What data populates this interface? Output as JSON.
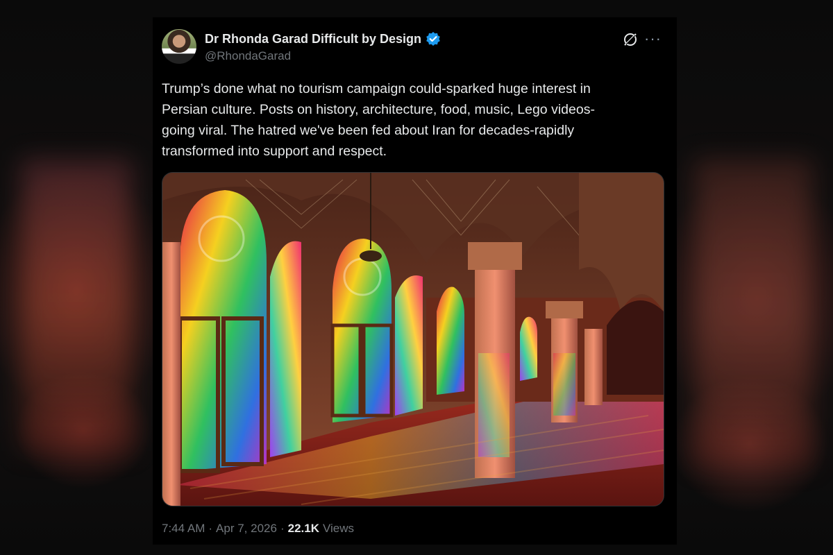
{
  "tweet": {
    "author": {
      "display_name": "Dr Rhonda Garad Difficult by Design",
      "handle": "@RhondaGarad",
      "verified": true
    },
    "text_lines": [
      "Trump’s done what no tourism campaign could-sparked huge interest in",
      "Persian culture. Posts on history, architecture, food, music, Lego videos-",
      "going viral. The hatred we've been fed about Iran for decades-rapidly",
      "transformed into support and respect."
    ],
    "time": "7:44 AM",
    "separator": "·",
    "date": "Apr 7, 2026",
    "views_count": "22.1K",
    "views_label": "Views",
    "more_label": "···"
  },
  "colors": {
    "background": "#000000",
    "text": "#e7e9ea",
    "muted": "#71767b",
    "verified": "#1d9bf0"
  },
  "icons": {
    "verified": "verified-badge-icon",
    "grok": "grok-icon",
    "more": "more-icon"
  }
}
